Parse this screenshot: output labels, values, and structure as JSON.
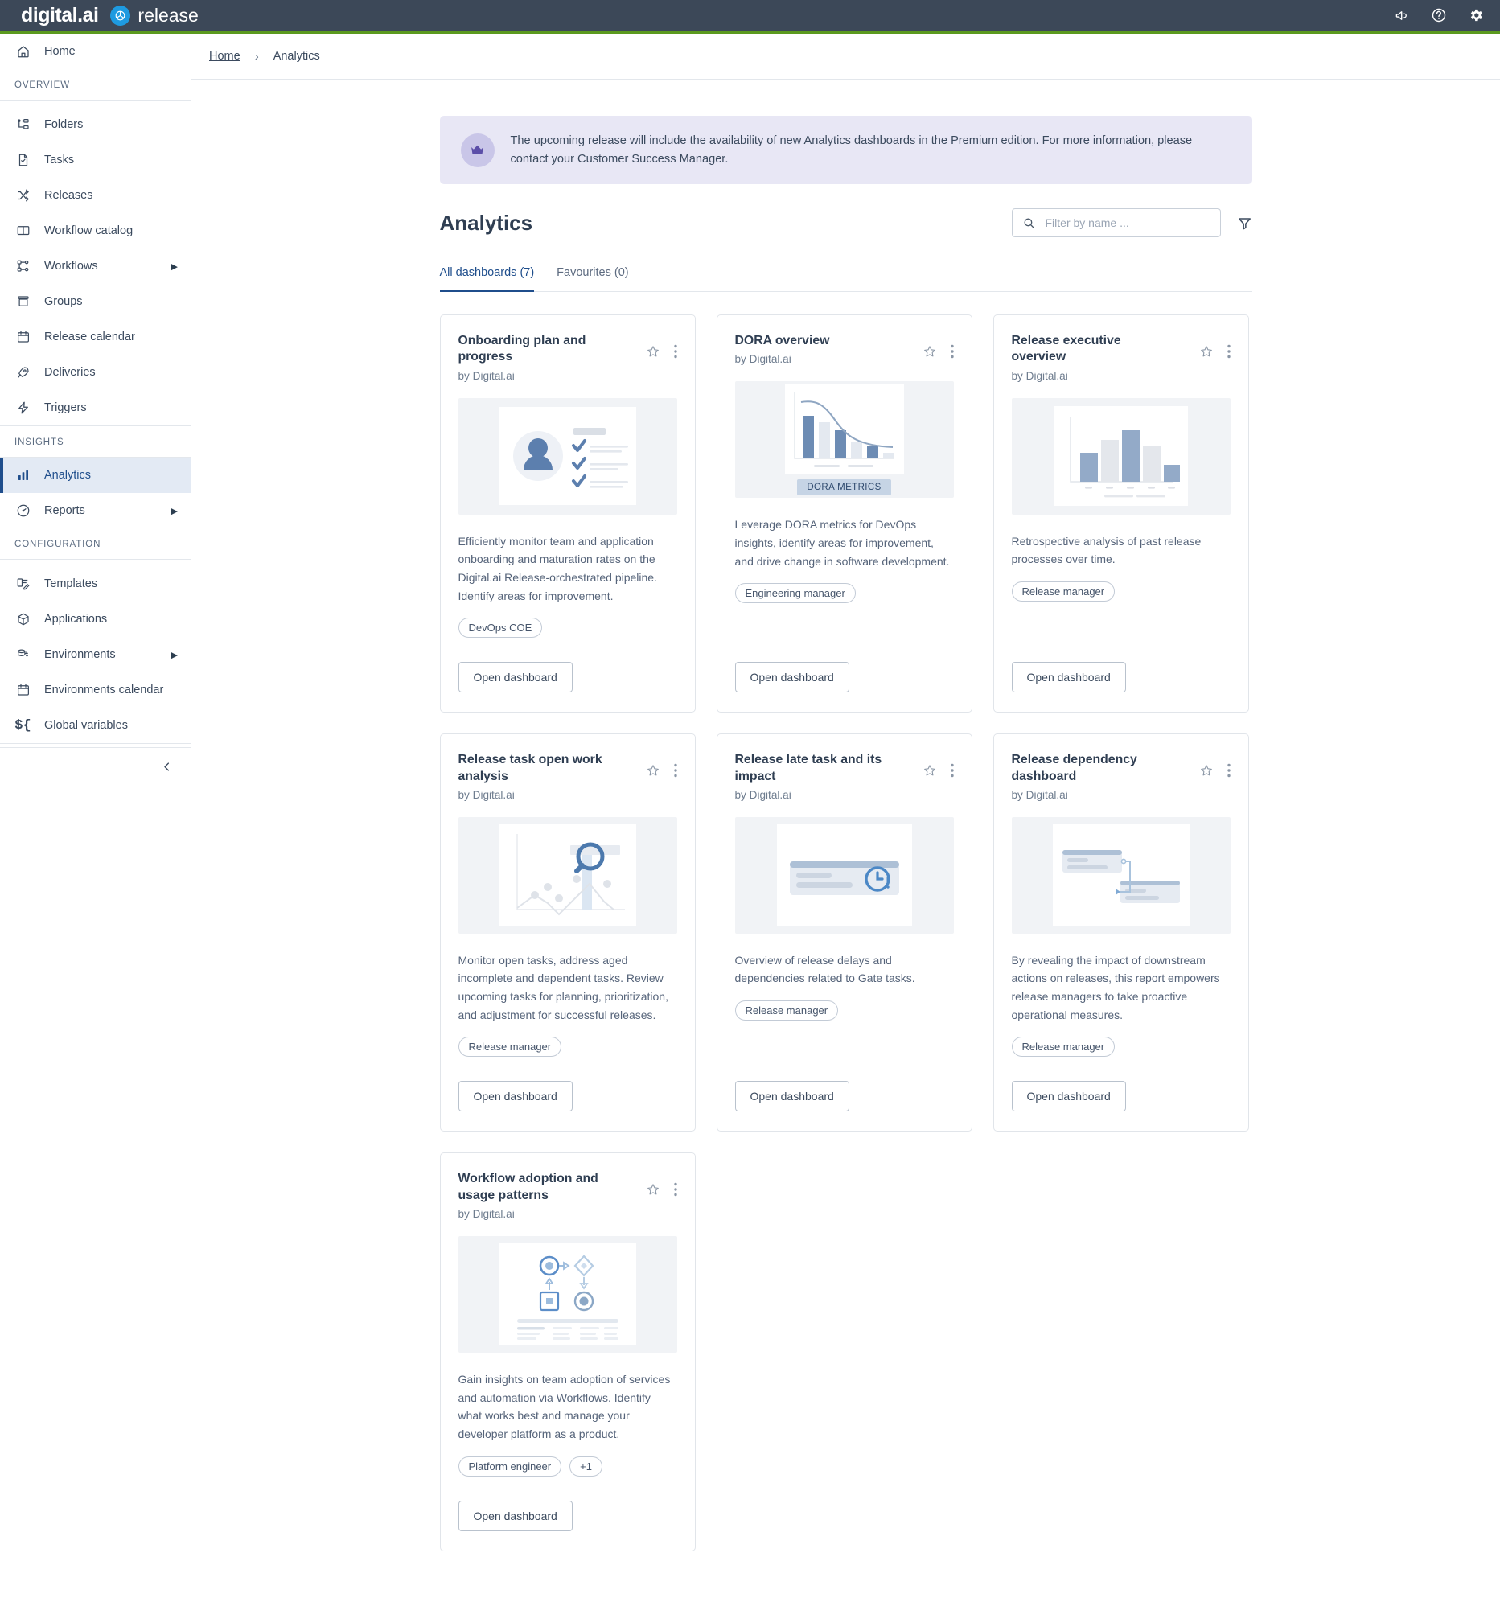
{
  "topbar": {
    "brand_primary": "digital.ai",
    "brand_secondary": "release",
    "icons": [
      "megaphone-icon",
      "help-icon",
      "settings-gear-icon"
    ]
  },
  "sidebar": {
    "home_label": "Home",
    "groups": [
      {
        "title": "OVERVIEW",
        "items": [
          {
            "label": "Folders",
            "icon": "folders-icon",
            "caret": false
          },
          {
            "label": "Tasks",
            "icon": "task-doc-icon",
            "caret": false
          },
          {
            "label": "Releases",
            "icon": "shuffle-icon",
            "caret": false
          },
          {
            "label": "Workflow catalog",
            "icon": "book-icon",
            "caret": false
          },
          {
            "label": "Workflows",
            "icon": "workflow-nodes-icon",
            "caret": true
          },
          {
            "label": "Groups",
            "icon": "groups-box-icon",
            "caret": false
          },
          {
            "label": "Release calendar",
            "icon": "calendar-icon",
            "caret": false
          },
          {
            "label": "Deliveries",
            "icon": "rocket-icon",
            "caret": false
          },
          {
            "label": "Triggers",
            "icon": "lightning-icon",
            "caret": false
          }
        ]
      },
      {
        "title": "INSIGHTS",
        "items": [
          {
            "label": "Analytics",
            "icon": "bar-chart-icon",
            "caret": false,
            "active": true
          },
          {
            "label": "Reports",
            "icon": "gauge-icon",
            "caret": true
          }
        ]
      },
      {
        "title": "CONFIGURATION",
        "items": [
          {
            "label": "Templates",
            "icon": "templates-icon",
            "caret": false
          },
          {
            "label": "Applications",
            "icon": "package-icon",
            "caret": false
          },
          {
            "label": "Environments",
            "icon": "environments-icon",
            "caret": true
          },
          {
            "label": "Environments calendar",
            "icon": "calendar-icon",
            "caret": false
          },
          {
            "label": "Global variables",
            "icon": "variable-icon",
            "caret": false
          }
        ]
      }
    ],
    "collapse_icon": "chevron-left-icon"
  },
  "breadcrumb": {
    "home": "Home",
    "separator": "›",
    "current": "Analytics"
  },
  "banner": {
    "icon": "crown-icon",
    "text": "The upcoming release will include the availability of new Analytics dashboards in the Premium edition. For more information, please contact your Customer Success Manager."
  },
  "page": {
    "title": "Analytics",
    "search_placeholder": "Filter by name ...",
    "search_value": "",
    "search_icon": "search-icon",
    "filter_icon": "funnel-filter-icon"
  },
  "tabs": [
    {
      "label": "All dashboards (7)",
      "active": true
    },
    {
      "label": "Favourites (0)",
      "active": false
    }
  ],
  "cards": [
    {
      "title": "Onboarding plan and progress",
      "author": "by Digital.ai",
      "thumb": "onboarding-checklist-thumbnail",
      "description": "Efficiently monitor team and application onboarding and maturation rates on the Digital.ai Release-orchestrated pipeline. Identify areas for improvement.",
      "tags": [
        "DevOps COE"
      ],
      "button": "Open dashboard"
    },
    {
      "title": "DORA overview",
      "author": "by Digital.ai",
      "thumb": "dora-metrics-chart-thumbnail",
      "thumb_badge": "DORA METRICS",
      "description": "Leverage DORA metrics for DevOps insights, identify areas for improvement, and drive change in software development.",
      "tags": [
        "Engineering manager"
      ],
      "button": "Open dashboard"
    },
    {
      "title": "Release executive overview",
      "author": "by Digital.ai",
      "thumb": "bar-chart-thumbnail",
      "description": "Retrospective analysis of past release processes over time.",
      "tags": [
        "Release manager"
      ],
      "button": "Open dashboard"
    },
    {
      "title": "Release task open work analysis",
      "author": "by Digital.ai",
      "thumb": "line-chart-magnifier-thumbnail",
      "description": "Monitor open tasks, address aged incomplete and dependent tasks. Review upcoming tasks for planning, prioritization, and adjustment for successful releases.",
      "tags": [
        "Release manager"
      ],
      "button": "Open dashboard"
    },
    {
      "title": "Release late task and its impact",
      "author": "by Digital.ai",
      "thumb": "late-task-clock-thumbnail",
      "description": "Overview of release delays and dependencies related to Gate tasks.",
      "tags": [
        "Release manager"
      ],
      "button": "Open dashboard"
    },
    {
      "title": "Release dependency dashboard",
      "author": "by Digital.ai",
      "thumb": "dependency-link-thumbnail",
      "description": "By revealing the impact of downstream actions on releases, this report empowers release managers to take proactive operational measures.",
      "tags": [
        "Release manager"
      ],
      "button": "Open dashboard"
    },
    {
      "title": "Workflow adoption and usage patterns",
      "author": "by Digital.ai",
      "thumb": "workflow-diagram-thumbnail",
      "description": "Gain insights on team adoption of services and automation via Workflows. Identify what works best and manage your developer platform as a product.",
      "tags": [
        "Platform engineer",
        "+1"
      ],
      "button": "Open dashboard"
    }
  ],
  "colors": {
    "topbar_bg": "#3c4858",
    "accent_green": "#5b9a1e",
    "brand_blue": "#1e9ae0",
    "active_blue": "#1f4e8c",
    "banner_bg": "#e8e7f5",
    "banner_badge": "#c9c6e8"
  }
}
